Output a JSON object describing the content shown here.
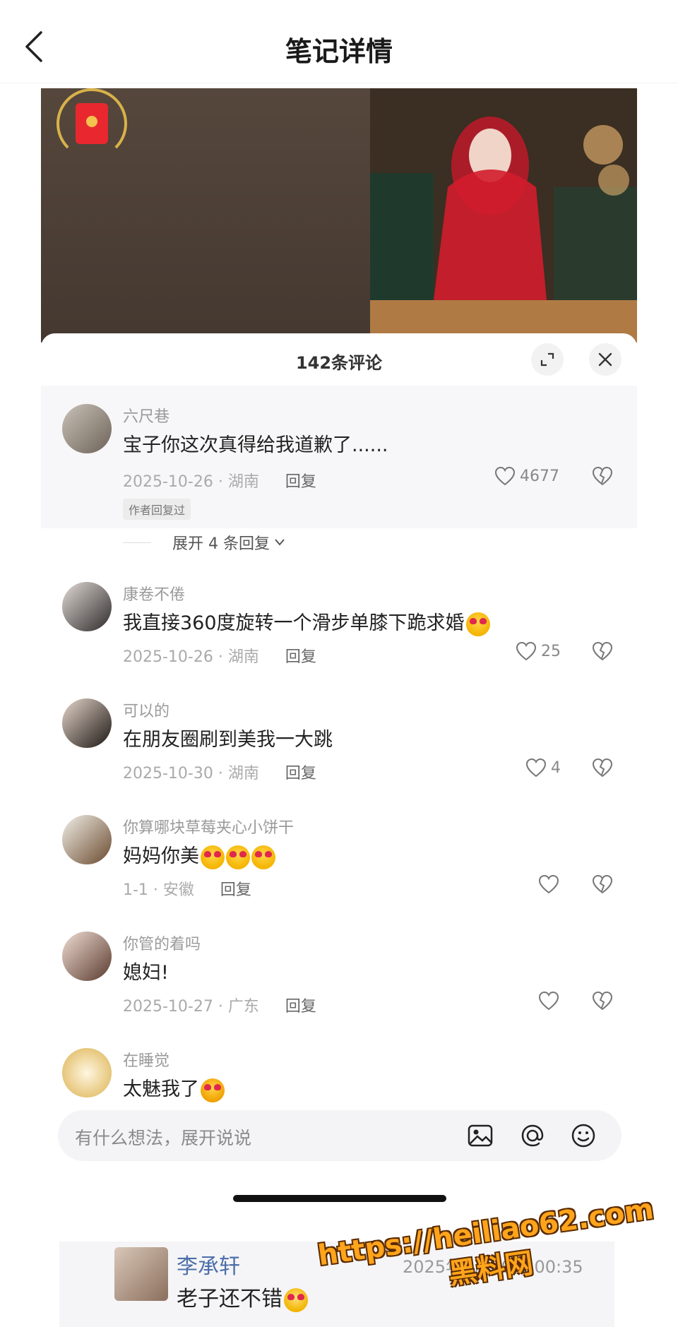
{
  "header": {
    "title": "笔记详情"
  },
  "sheet": {
    "comment_count": "142条评论"
  },
  "comments": [
    {
      "user": "六尺巷",
      "text": "宝子你这次真得给我道歉了......",
      "meta": "2025-10-26 · 湖南",
      "reply": "回复",
      "likes": "4677",
      "author_tag": "作者回复过",
      "expand": "展开 4 条回复"
    },
    {
      "user": "康卷不倦",
      "text": "我直接360度旋转一个滑步单膝下跪求婚",
      "meta": "2025-10-26 · 湖南",
      "reply": "回复",
      "likes": "25"
    },
    {
      "user": "可以的",
      "text": "在朋友圈刷到美我一大跳",
      "meta": "2025-10-30 · 湖南",
      "reply": "回复",
      "likes": "4"
    },
    {
      "user": "你算哪块草莓夹心小饼干",
      "text": "妈妈你美",
      "meta": "1-1 · 安徽",
      "reply": "回复",
      "likes": ""
    },
    {
      "user": "你管的着吗",
      "text": "媳妇!",
      "meta": "2025-10-27 · 广东",
      "reply": "回复",
      "likes": ""
    },
    {
      "user": "在睡觉",
      "text": "太魅我了"
    }
  ],
  "input": {
    "placeholder": "有什么想法，展开说说"
  },
  "chat_card": {
    "name": "李承轩",
    "time": "2025年9月30日 00:35",
    "message": "老子还不错"
  },
  "watermark": {
    "url": "https://heiliao62.com",
    "name": "黑料网"
  },
  "icons": {
    "back": "chevron-left-icon",
    "expand": "expand-icon",
    "close": "close-icon",
    "like": "heart-icon",
    "dislike": "broken-heart-icon",
    "image": "image-icon",
    "mention": "at-icon",
    "emoji": "emoji-icon"
  },
  "colors": {
    "accent": "#e8282e",
    "link_name": "#4d6fa8",
    "watermark": "#ffa41b"
  }
}
